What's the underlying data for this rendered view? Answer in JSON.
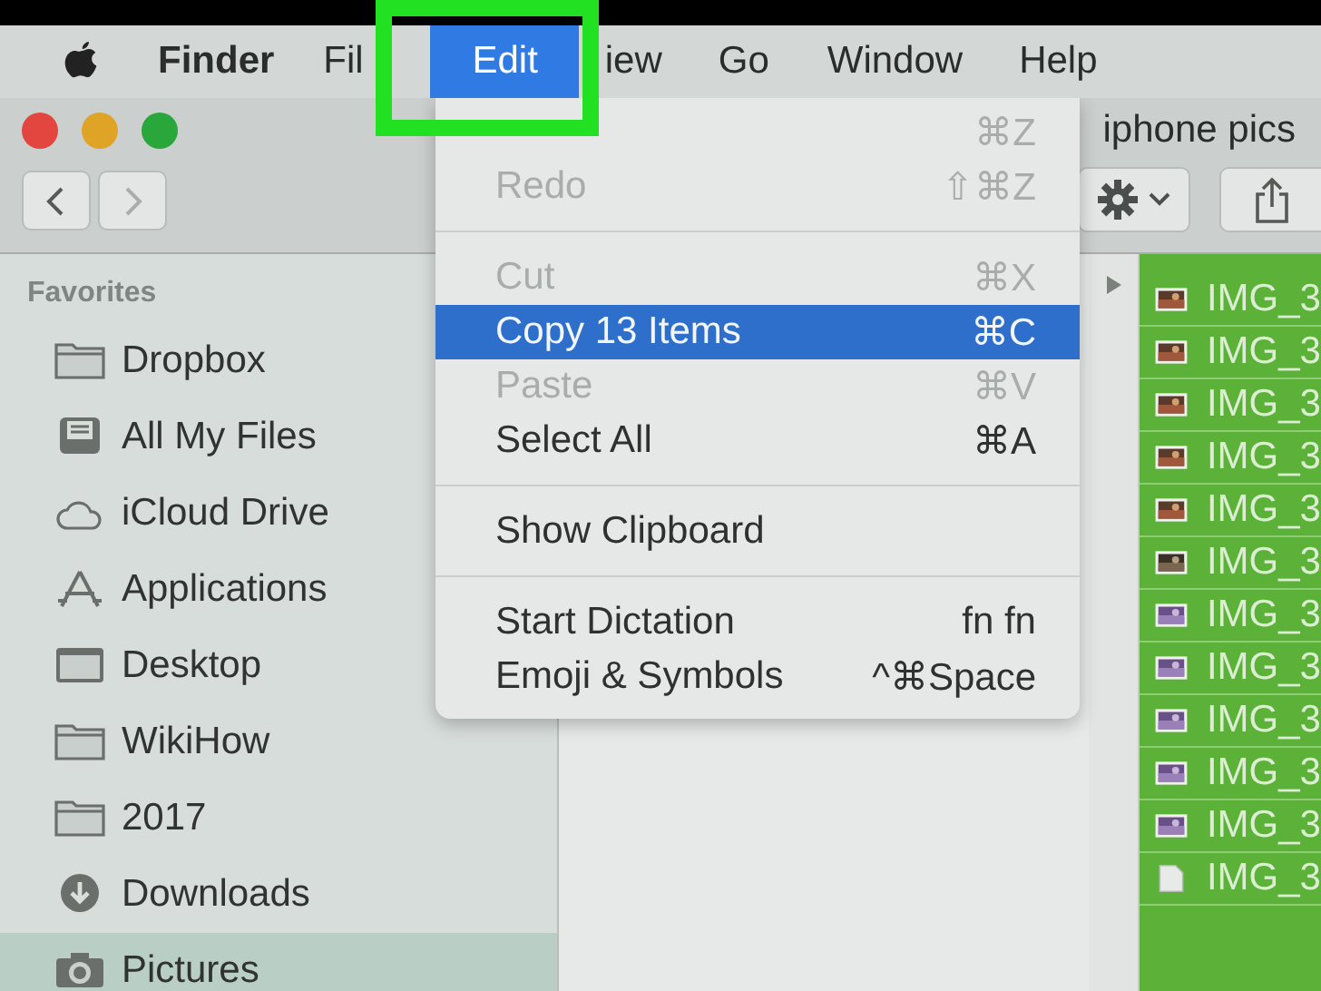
{
  "menu_bar": {
    "items": [
      {
        "kind": "apple"
      },
      {
        "kind": "app",
        "label": "Finder"
      },
      {
        "kind": "menu",
        "label": "Fil",
        "selected": false,
        "highlighted": false
      },
      {
        "kind": "menu",
        "label": "Edit",
        "selected": true,
        "highlighted": true
      },
      {
        "kind": "menu",
        "label": "iew",
        "selected": false,
        "highlighted": false
      },
      {
        "kind": "menu",
        "label": "Go",
        "selected": false,
        "highlighted": false
      },
      {
        "kind": "menu",
        "label": "Window",
        "selected": false,
        "highlighted": false
      },
      {
        "kind": "menu",
        "label": "Help",
        "selected": false,
        "highlighted": false
      }
    ]
  },
  "window": {
    "title": "iphone pics",
    "navigation": {
      "back_disabled": false,
      "forward_disabled": true
    }
  },
  "edit_menu": {
    "items": [
      {
        "kind": "item",
        "shortcut": "⌘Z",
        "disabled": true,
        "selected": false
      },
      {
        "kind": "item",
        "label": "Redo",
        "shortcut": "⇧⌘Z",
        "disabled": true,
        "selected": false
      },
      {
        "kind": "separator"
      },
      {
        "kind": "item",
        "label": "Cut",
        "shortcut": "⌘X",
        "disabled": true,
        "selected": false
      },
      {
        "kind": "item",
        "label": "Copy 13 Items",
        "shortcut": "⌘C",
        "disabled": false,
        "selected": true
      },
      {
        "kind": "item",
        "label": "Paste",
        "shortcut": "⌘V",
        "disabled": true,
        "selected": false
      },
      {
        "kind": "item",
        "label": "Select All",
        "shortcut": "⌘A",
        "disabled": false,
        "selected": false
      },
      {
        "kind": "separator"
      },
      {
        "kind": "item",
        "label": "Show Clipboard",
        "disabled": false,
        "selected": false
      },
      {
        "kind": "separator"
      },
      {
        "kind": "item",
        "label": "Start Dictation",
        "shortcut": "fn fn",
        "disabled": false,
        "selected": false
      },
      {
        "kind": "item",
        "label": "Emoji & Symbols",
        "shortcut": "^⌘Space",
        "disabled": false,
        "selected": false
      }
    ]
  },
  "sidebar": {
    "heading": "Favorites",
    "items": [
      {
        "kind": "folder",
        "label": "Dropbox",
        "selected": false
      },
      {
        "kind": "files",
        "label": "All My Files",
        "selected": false
      },
      {
        "kind": "cloud",
        "label": "iCloud Drive",
        "selected": false
      },
      {
        "kind": "apps",
        "label": "Applications",
        "selected": false
      },
      {
        "kind": "desktop",
        "label": "Desktop",
        "selected": false
      },
      {
        "kind": "folder",
        "label": "WikiHow",
        "selected": false
      },
      {
        "kind": "folder",
        "label": "2017",
        "selected": false
      },
      {
        "kind": "download",
        "label": "Downloads",
        "selected": false
      },
      {
        "kind": "camera",
        "label": "Pictures",
        "selected": true
      }
    ]
  },
  "file_list": {
    "disclosure": {
      "expanded": false
    },
    "files": [
      {
        "name": "IMG_3",
        "selected": true
      },
      {
        "name": "IMG_3",
        "selected": true
      },
      {
        "name": "IMG_3",
        "selected": true
      },
      {
        "name": "IMG_3",
        "selected": true
      },
      {
        "name": "IMG_3",
        "selected": true
      },
      {
        "name": "IMG_3",
        "selected": true
      },
      {
        "name": "IMG_3",
        "selected": true
      },
      {
        "name": "IMG_3",
        "selected": true
      },
      {
        "name": "IMG_3",
        "selected": true
      },
      {
        "name": "IMG_3",
        "selected": true
      },
      {
        "name": "IMG_3",
        "selected": true
      },
      {
        "kind": "document",
        "name": "IMG_3",
        "selected": true
      }
    ]
  }
}
